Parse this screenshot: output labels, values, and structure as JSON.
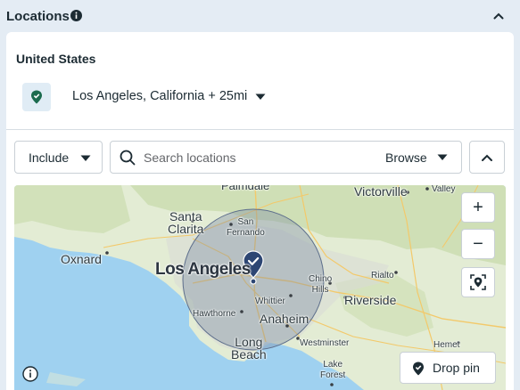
{
  "header": {
    "title": "Locations",
    "info_icon": "info-icon",
    "collapse_icon": "chevron-up-icon"
  },
  "location": {
    "country": "United States",
    "selected": "Los Angeles, California + 25mi",
    "pin_color": "#1b6b4e"
  },
  "filter": {
    "include_label": "Include",
    "search_placeholder": "Search locations",
    "browse_label": "Browse"
  },
  "map": {
    "cities": {
      "palmdale": "Palmdale",
      "victorville": "Victorville",
      "valley": "Valley",
      "santa_clarita": "Santa\nClarita",
      "san_fernando": "San\nFernando",
      "oxnard": "Oxnard",
      "los_angeles": "Los Angeles",
      "rialto": "Rialto",
      "chino_hills": "Chino\nHills",
      "riverside": "Riverside",
      "whittier": "Whittier",
      "hawthorne": "Hawthorne",
      "anaheim": "Anaheim",
      "long_beach": "Long\nBeach",
      "westminster": "Westminster",
      "hemet": "Hemet",
      "lake_forest": "Lake\nForest"
    },
    "zoom_in": "+",
    "zoom_out": "−",
    "drop_pin_label": "Drop pin",
    "ocean_color": "#9fd1f0",
    "land_color": "#e3ecd4",
    "radius_fill": "#7f8ea8"
  }
}
